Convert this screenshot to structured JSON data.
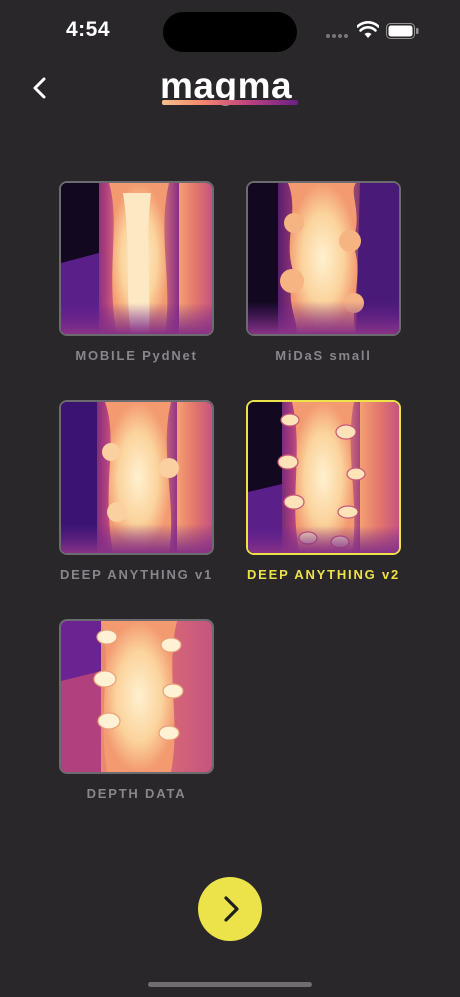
{
  "status": {
    "time": "4:54"
  },
  "header": {
    "logo_text": "magma"
  },
  "models": [
    {
      "label": "MOBILE PydNet",
      "selected": false
    },
    {
      "label": "MiDaS small",
      "selected": false
    },
    {
      "label": "DEEP ANYTHING v1",
      "selected": false
    },
    {
      "label": "DEEP ANYTHING v2",
      "selected": true
    },
    {
      "label": "DEPTH DATA",
      "selected": false
    }
  ],
  "colors": {
    "background": "#29272a",
    "accent": "#ece24a",
    "label_inactive": "#87868a",
    "magma_dark": "#1a0c2e",
    "magma_purple": "#6a2390",
    "magma_magenta": "#c2447f",
    "magma_orange": "#f4866e",
    "magma_light": "#fbe3b6"
  },
  "icons": {
    "back": "chevron-left-icon",
    "next": "chevron-right-icon",
    "wifi": "wifi-icon",
    "battery": "battery-icon"
  }
}
